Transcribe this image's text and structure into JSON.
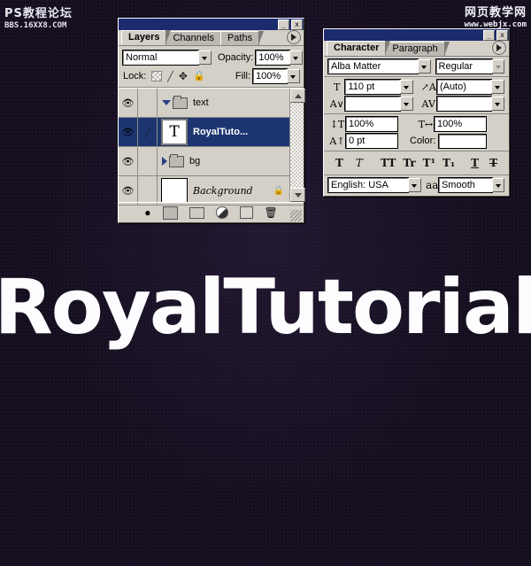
{
  "canvas": {
    "background_color": "#150e1e",
    "headline_text": "RoyalTutorial",
    "headline_color": "#fdfdff"
  },
  "watermark_left": {
    "title": "PS教程论坛",
    "url": "BBS.16XX8.COM"
  },
  "watermark_right": {
    "title": "网页教学网",
    "url": "www.webjx.com"
  },
  "layers_panel": {
    "titlebar": {
      "minimize_label": "_",
      "close_label": "x"
    },
    "tabs": [
      {
        "label": "Layers",
        "active": true
      },
      {
        "label": "Channels",
        "active": false
      },
      {
        "label": "Paths",
        "active": false
      }
    ],
    "blend_mode": "Normal",
    "opacity_label": "Opacity:",
    "opacity_value": "100%",
    "lock_label": "Lock:",
    "fill_label": "Fill:",
    "fill_value": "100%",
    "lock_icons": [
      "transparency-icon",
      "brush-icon",
      "move-icon",
      "lock-all-icon"
    ],
    "rows": [
      {
        "name": "text",
        "type": "group",
        "expanded": true,
        "selected": false,
        "thumb": "folder"
      },
      {
        "name": "RoyalTuto...",
        "type": "text",
        "expanded": false,
        "selected": true,
        "thumb": "T",
        "linked": true
      },
      {
        "name": "bg",
        "type": "group",
        "expanded": false,
        "selected": false,
        "thumb": "folder"
      },
      {
        "name": "Background",
        "type": "layer",
        "expanded": false,
        "selected": false,
        "thumb": "blank",
        "locked": true
      }
    ],
    "footer_buttons": [
      "layer-style-icon",
      "layer-mask-icon",
      "new-group-icon",
      "adjustment-layer-icon",
      "new-layer-icon",
      "delete-layer-icon"
    ]
  },
  "character_panel": {
    "titlebar": {
      "minimize_label": "_",
      "close_label": "x"
    },
    "tabs": [
      {
        "label": "Character",
        "active": true
      },
      {
        "label": "Paragraph",
        "active": false
      }
    ],
    "font_family": "Alba Matter",
    "font_style": "Regular",
    "font_size": "110 pt",
    "leading": "(Auto)",
    "kerning": "",
    "tracking": "",
    "vertical_scale": "100%",
    "horizontal_scale": "100%",
    "baseline_shift": "0 pt",
    "color_label": "Color:",
    "color_value": "#ffffff",
    "style_buttons": [
      "bold",
      "italic",
      "all-caps",
      "small-caps",
      "superscript",
      "subscript",
      "underline",
      "strikethrough"
    ],
    "style_button_glyphs": [
      "T",
      "T",
      "TT",
      "Tr",
      "T¹",
      "T₁",
      "T",
      "T"
    ],
    "language": "English: USA",
    "antialias_label": "aa",
    "antialias_value": "Smooth"
  }
}
